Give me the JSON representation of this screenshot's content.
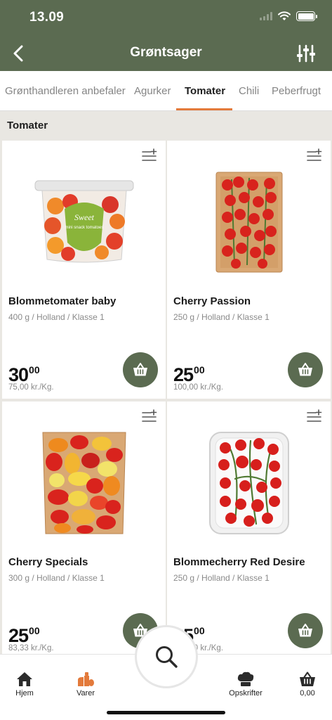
{
  "status_bar": {
    "time": "13.09"
  },
  "header": {
    "title": "Grøntsager"
  },
  "tabs": [
    {
      "label": "Grønthandleren anbefaler"
    },
    {
      "label": "Agurker"
    },
    {
      "label": "Tomater"
    },
    {
      "label": "Chili"
    },
    {
      "label": "Peberfrugt"
    }
  ],
  "active_tab": "Tomater",
  "section": {
    "title": "Tomater"
  },
  "products": [
    {
      "name": "Blommetomater baby",
      "desc": "400 g / Holland / Klasse 1",
      "price_int": "30",
      "price_dec": "00",
      "unit_price": "75,00 kr./Kg.",
      "label_top": "Sweet",
      "label_bottom": "mini snack tomatoes"
    },
    {
      "name": "Cherry Passion",
      "desc": "250 g / Holland / Klasse 1",
      "price_int": "25",
      "price_dec": "00",
      "unit_price": "100,00 kr./Kg."
    },
    {
      "name": "Cherry Specials",
      "desc": "300 g / Holland / Klasse 1",
      "price_int": "25",
      "price_dec": "00",
      "unit_price": "83,33 kr./Kg."
    },
    {
      "name": "Blommecherry Red Desire",
      "desc": "250 g / Holland / Klasse 1",
      "price_int": "25",
      "price_dec": "00",
      "unit_price": "100,00 kr./Kg."
    }
  ],
  "bottom_nav": {
    "home": "Hjem",
    "products": "Varer",
    "recipes": "Opskrifter",
    "basket_total": "0,00"
  },
  "colors": {
    "brand_green": "#5b6b51",
    "accent_orange": "#e37a3b",
    "background": "#e9e7e2"
  }
}
